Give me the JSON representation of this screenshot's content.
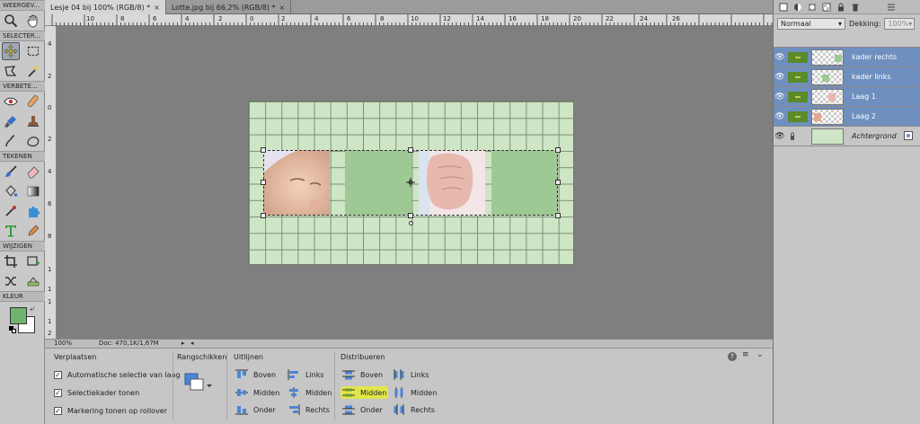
{
  "toolbox": {
    "sections": [
      "WEERGEV...",
      "SELECTER...",
      "VERBETE...",
      "TEKENEN",
      "WIJZIGEN",
      "KLEUR"
    ],
    "colors": {
      "foreground": "#6fb56f",
      "background": "#ffffff"
    }
  },
  "tabs": [
    {
      "label": "Lesje 04 bij 100% (RGB/8) *",
      "close": "×"
    },
    {
      "label": "Lotte.jpg bij 66,2% (RGB/8) *",
      "close": "×"
    }
  ],
  "rulers": {
    "top": [
      "10",
      "8",
      "6",
      "4",
      "2",
      "0",
      "2",
      "4",
      "6",
      "8",
      "10",
      "12",
      "14",
      "16",
      "18",
      "20",
      "22",
      "24",
      "26"
    ],
    "left": [
      "4",
      "2",
      "0",
      "2",
      "4",
      "6",
      "8",
      "1",
      "1",
      "1",
      "1",
      "2"
    ]
  },
  "status": {
    "zoom": "100%",
    "doc": "Doc: 470,1K/1,67M"
  },
  "options": {
    "move": {
      "title": "Verplaatsen",
      "checks": [
        "Automatische selectie van laag",
        "Selectiekader tonen",
        "Markering tonen op rollover"
      ]
    },
    "arrange": {
      "title": "Rangschikken"
    },
    "align": {
      "title": "Uitlijnen",
      "col1": [
        "Boven",
        "Midden",
        "Onder"
      ],
      "col2": [
        "Links",
        "Midden",
        "Rechts"
      ]
    },
    "distribute": {
      "title": "Distribueren",
      "col1": [
        "Boven",
        "Midden",
        "Onder"
      ],
      "col2": [
        "Links",
        "Midden",
        "Rechts"
      ]
    },
    "help": "?"
  },
  "layers": {
    "blend_mode": "Normaal",
    "opacity_label": "Dekking:",
    "opacity_value": "100%",
    "items": [
      {
        "name": "kader rechts"
      },
      {
        "name": "kader links"
      },
      {
        "name": "Laag 1"
      },
      {
        "name": "Laag 2"
      },
      {
        "name": "Achtergrond"
      }
    ]
  }
}
